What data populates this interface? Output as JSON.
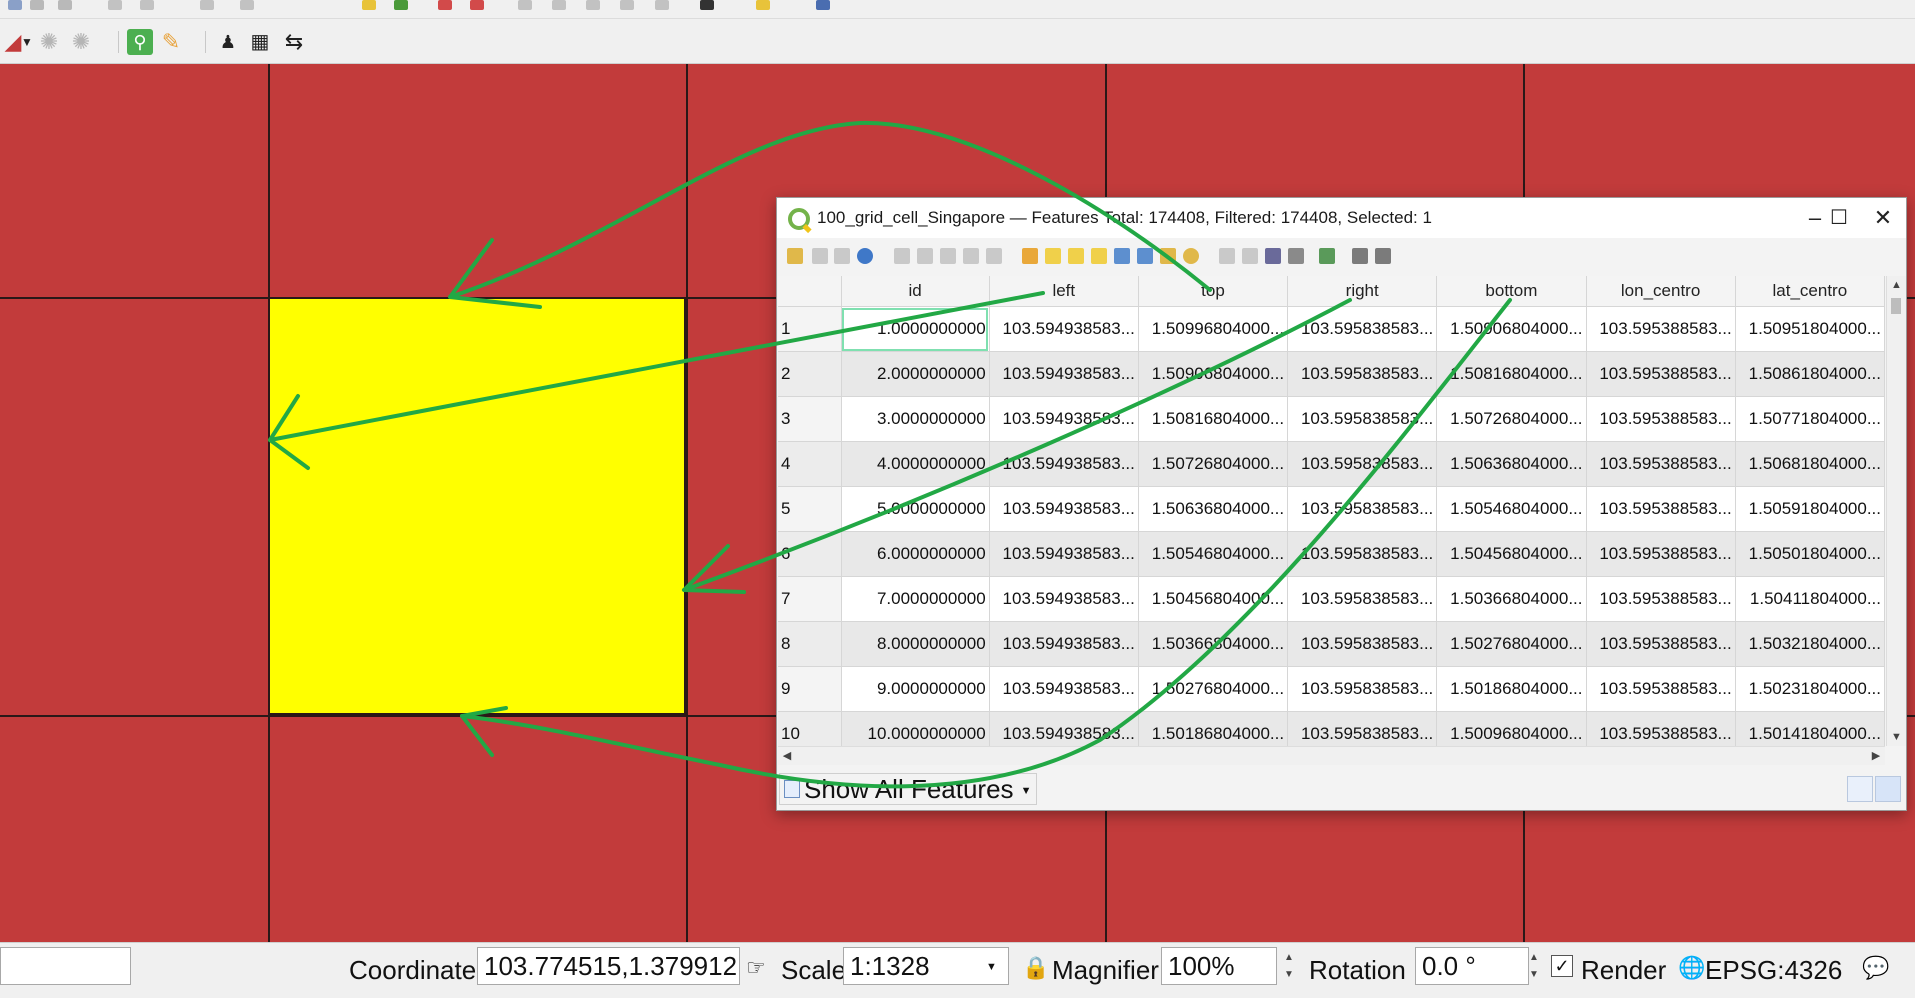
{
  "window": {
    "title": "100_grid_cell_Singapore — Features Total: 174408, Filtered: 174408, Selected: 1",
    "minimize_icon": "minimize-icon",
    "maximize_icon": "maximize-icon",
    "close_icon": "close-icon"
  },
  "table": {
    "columns": [
      "id",
      "left",
      "top",
      "right",
      "bottom",
      "lon_centro",
      "lat_centro"
    ],
    "rows": [
      {
        "n": "1",
        "cells": [
          "1.0000000000",
          "103.594938583...",
          "1.50996804000...",
          "103.595838583...",
          "1.50906804000...",
          "103.595388583...",
          "1.50951804000..."
        ]
      },
      {
        "n": "2",
        "cells": [
          "2.0000000000",
          "103.594938583...",
          "1.50906804000...",
          "103.595838583...",
          "1.50816804000...",
          "103.595388583...",
          "1.50861804000..."
        ]
      },
      {
        "n": "3",
        "cells": [
          "3.0000000000",
          "103.594938583...",
          "1.50816804000...",
          "103.595838583...",
          "1.50726804000...",
          "103.595388583...",
          "1.50771804000..."
        ]
      },
      {
        "n": "4",
        "cells": [
          "4.0000000000",
          "103.594938583...",
          "1.50726804000...",
          "103.595838583...",
          "1.50636804000...",
          "103.595388583...",
          "1.50681804000..."
        ]
      },
      {
        "n": "5",
        "cells": [
          "5.0000000000",
          "103.594938583...",
          "1.50636804000...",
          "103.595838583...",
          "1.50546804000...",
          "103.595388583...",
          "1.50591804000..."
        ]
      },
      {
        "n": "6",
        "cells": [
          "6.0000000000",
          "103.594938583...",
          "1.50546804000...",
          "103.595838583...",
          "1.50456804000...",
          "103.595388583...",
          "1.50501804000..."
        ]
      },
      {
        "n": "7",
        "cells": [
          "7.0000000000",
          "103.594938583...",
          "1.50456804000...",
          "103.595838583...",
          "1.50366804000...",
          "103.595388583...",
          "1.50411804000..."
        ]
      },
      {
        "n": "8",
        "cells": [
          "8.0000000000",
          "103.594938583...",
          "1.50366804000...",
          "103.595838583...",
          "1.50276804000...",
          "103.595388583...",
          "1.50321804000..."
        ]
      },
      {
        "n": "9",
        "cells": [
          "9.0000000000",
          "103.594938583...",
          "1.50276804000...",
          "103.595838583...",
          "1.50186804000...",
          "103.595388583...",
          "1.50231804000..."
        ]
      },
      {
        "n": "10",
        "cells": [
          "10.0000000000",
          "103.594938583...",
          "1.50186804000...",
          "103.595838583...",
          "1.50096804000...",
          "103.595388583...",
          "1.50141804000..."
        ]
      }
    ]
  },
  "filter": {
    "label": "Show All Features"
  },
  "status": {
    "coordinate_label": "Coordinate",
    "coordinate_value": "103.774515,1.379912",
    "scale_label": "Scale",
    "scale_value": "1:1328",
    "magnifier_label": "Magnifier",
    "magnifier_value": "100%",
    "rotation_label": "Rotation",
    "rotation_value": "0.0 °",
    "render_label": "Render",
    "render_checked": "✓",
    "crs_label": "EPSG:4326"
  },
  "colors": {
    "map_fill": "#c23b3b",
    "selected_fill": "#ffff00",
    "annotation_arrows": "#22a845"
  }
}
